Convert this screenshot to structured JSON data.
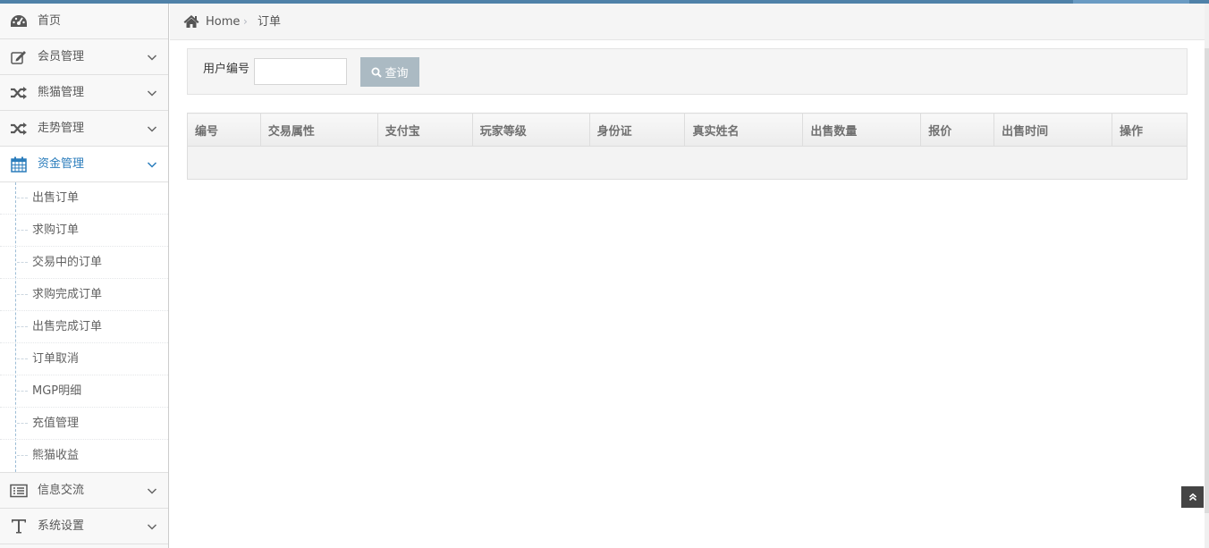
{
  "sidebar": {
    "items": [
      {
        "label": "首页",
        "icon": "dashboard-icon"
      },
      {
        "label": "会员管理",
        "icon": "edit-icon"
      },
      {
        "label": "熊猫管理",
        "icon": "random-icon"
      },
      {
        "label": "走势管理",
        "icon": "random-icon"
      },
      {
        "label": "资金管理",
        "icon": "calendar-icon"
      },
      {
        "label": "信息交流",
        "icon": "list-icon"
      },
      {
        "label": "系统设置",
        "icon": "text-icon"
      }
    ],
    "submenu": [
      "出售订单",
      "求购订单",
      "交易中的订单",
      "求购完成订单",
      "出售完成订单",
      "订单取消",
      "MGP明细",
      "充值管理",
      "熊猫收益"
    ]
  },
  "breadcrumb": {
    "home": "Home",
    "separator": "›",
    "current": "订单"
  },
  "search": {
    "label": "用户编号",
    "value": "",
    "button": "查询"
  },
  "table": {
    "columns": [
      "编号",
      "交易属性",
      "支付宝",
      "玩家等级",
      "身份证",
      "真实姓名",
      "出售数量",
      "报价",
      "出售时间",
      "操作"
    ]
  },
  "colors": {
    "accent": "#2b7dbc",
    "topbar": "#4f81a8",
    "button": "#abbac3"
  }
}
